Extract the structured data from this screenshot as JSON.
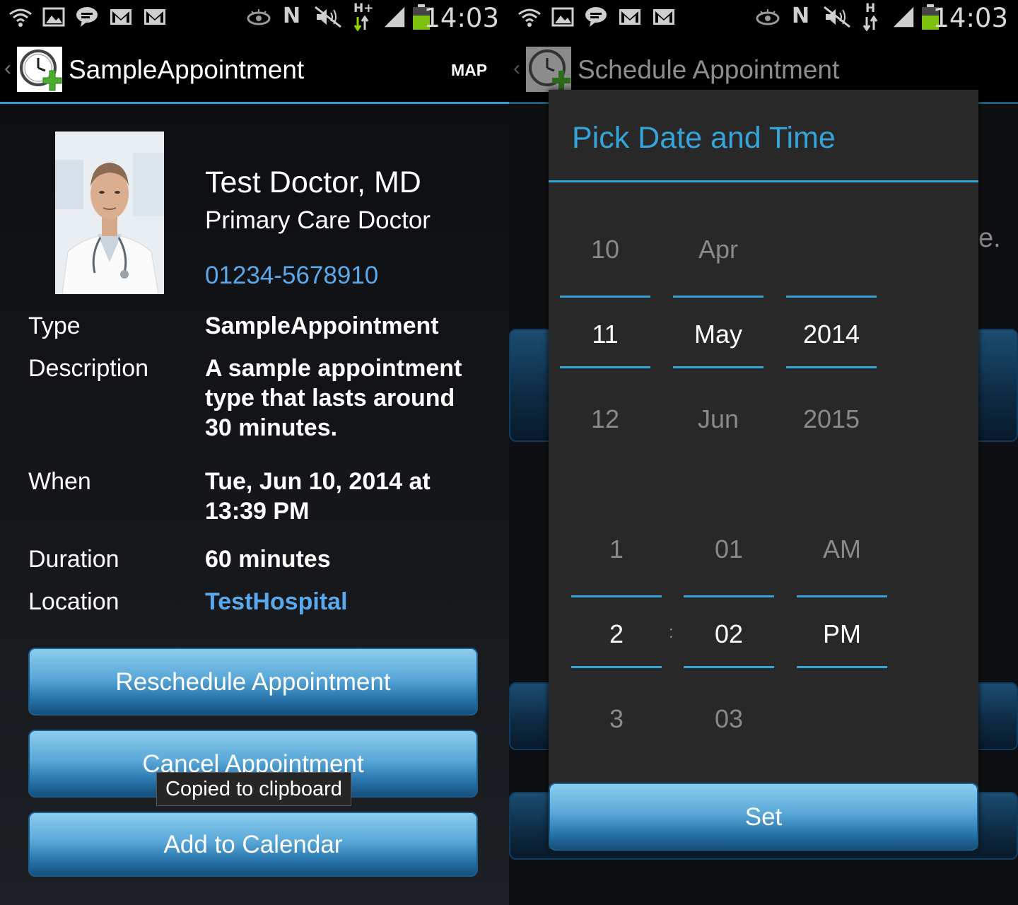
{
  "status_bar": {
    "time": "14:03",
    "network_left": "H+",
    "network_right": "H",
    "nfc_label": "N",
    "icons": [
      "wifi-icon",
      "image-icon",
      "chat-icon",
      "gmail-icon",
      "gmail-icon",
      "eye-icon",
      "nfc-icon",
      "mute-icon",
      "data-arrows-icon",
      "signal-icon",
      "battery-icon"
    ],
    "battery_color": "#7cc10e"
  },
  "detail_screen": {
    "title": "SampleAppointment",
    "action": "MAP",
    "doctor": {
      "name": "Test Doctor, MD",
      "specialty": "Primary Care Doctor",
      "phone": "01234-5678910"
    },
    "fields": [
      {
        "label": "Type",
        "value": "SampleAppointment"
      },
      {
        "label": "Description",
        "value": "A sample appointment type that lasts around 30 minutes."
      },
      {
        "label": "When",
        "value": "Tue, Jun 10, 2014 at 13:39 PM"
      },
      {
        "label": "Duration",
        "value": "60 minutes"
      },
      {
        "label": "Location",
        "value": "TestHospital"
      }
    ],
    "buttons": {
      "reschedule": "Reschedule Appointment",
      "cancel": "Cancel Appointment",
      "calendar": "Add to Calendar"
    },
    "toast": "Copied to clipboard"
  },
  "schedule_screen": {
    "title": "Schedule Appointment",
    "background_fragment": "e.",
    "dialog": {
      "title": "Pick Date and Time",
      "date": {
        "day": {
          "prev": "10",
          "selected": "11",
          "next": "12"
        },
        "month": {
          "prev": "Apr",
          "selected": "May",
          "next": "Jun"
        },
        "year": {
          "prev": "",
          "selected": "2014",
          "next": "2015"
        }
      },
      "time": {
        "hour": {
          "prev": "1",
          "selected": "2",
          "next": "3"
        },
        "separator": ":",
        "minute": {
          "prev": "01",
          "selected": "02",
          "next": "03"
        },
        "ampm": {
          "prev": "AM",
          "selected": "PM",
          "next": ""
        }
      },
      "set_button": "Set"
    }
  },
  "colors": {
    "accent": "#35a4d8",
    "link": "#5aa9ec",
    "button_top": "#8ccdee",
    "button_bottom": "#154e7c"
  }
}
